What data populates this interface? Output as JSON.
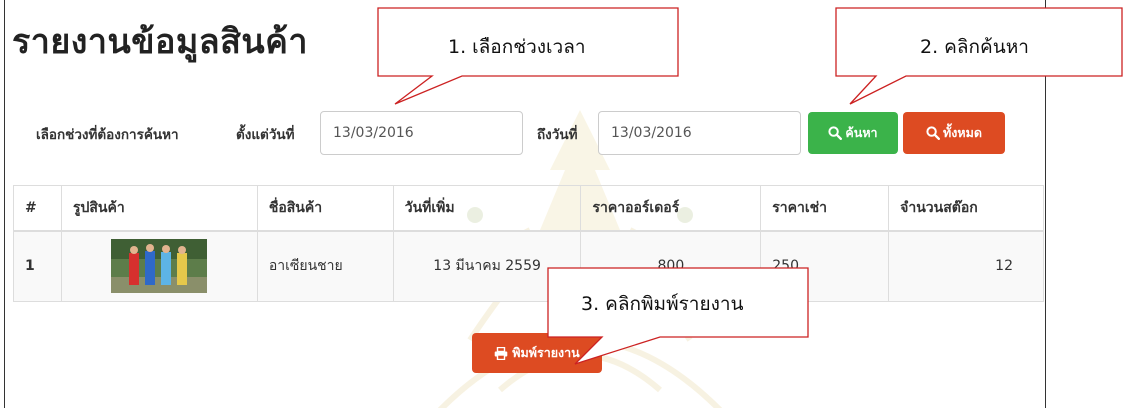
{
  "page": {
    "title": "รายงานข้อมูลสินค้า"
  },
  "filter": {
    "range_label": "เลือกช่วงที่ต้องการค้นหา",
    "from_label": "ตั้งแต่วันที่",
    "from_value": "13/03/2016",
    "to_label": "ถึงวันที่",
    "to_value": "13/03/2016",
    "search_label": "ค้นหา",
    "show_all_label": "ทั้งหมด",
    "search_icon": "search-icon"
  },
  "table": {
    "headers": [
      "#",
      "รูปสินค้า",
      "ชื่อสินค้า",
      "วันที่เพิ่ม",
      "ราคาออร์เดอร์",
      "ราคาเช่า",
      "จำนวนสต๊อก"
    ],
    "rows": [
      {
        "num": "1",
        "image": "product-photo",
        "name": "อาเซียนชาย",
        "date_added": "13 มีนาคม 2559",
        "order_price": "800",
        "rent_price": "250",
        "stock": "12"
      }
    ]
  },
  "print": {
    "label": "พิมพ์รายงาน",
    "icon": "printer-icon"
  },
  "callouts": {
    "step1": "1. เลือกช่วงเวลา",
    "step2": "2. คลิกค้นหา",
    "step3": "3. คลิกพิมพ์รายงาน"
  },
  "colors": {
    "search_button": "#3bb34a",
    "show_all_button": "#dd4b22",
    "print_button": "#dd4b22",
    "callout_border": "#cc2222"
  }
}
